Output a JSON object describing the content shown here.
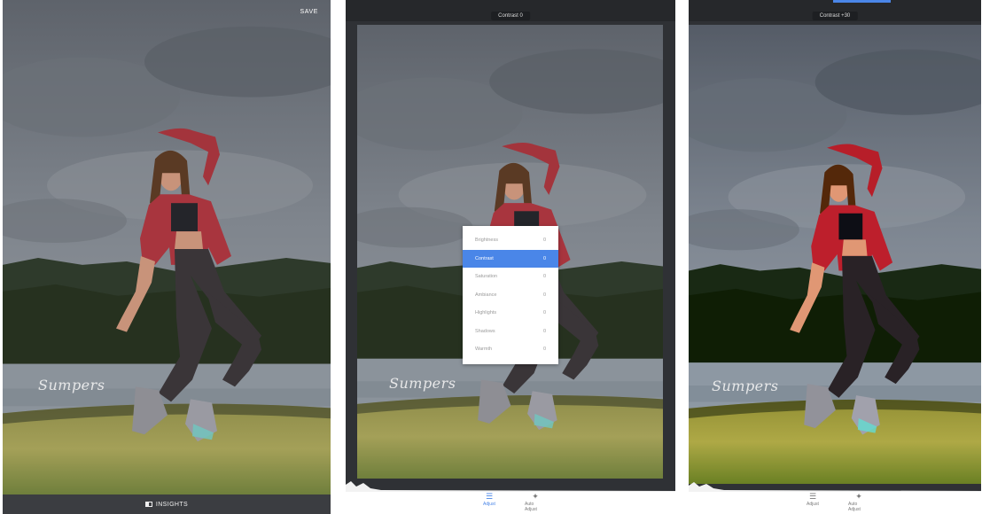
{
  "colors": {
    "accent": "#4a86e8",
    "dark": "#2f3135",
    "menu_bg": "#ffffff"
  },
  "panel1": {
    "save_label": "SAVE",
    "signature_text": "Sumpers",
    "insights_icon": "insights-icon",
    "insights_label": "INSIGHTS"
  },
  "panel2": {
    "indicator": "Contrast 0",
    "signature_text": "Sumpers",
    "menu": [
      {
        "label": "Brightness",
        "value": "0"
      },
      {
        "label": "Contrast",
        "value": "0"
      },
      {
        "label": "Saturation",
        "value": "0"
      },
      {
        "label": "Ambiance",
        "value": "0"
      },
      {
        "label": "Highlights",
        "value": "0"
      },
      {
        "label": "Shadows",
        "value": "0"
      },
      {
        "label": "Warmth",
        "value": "0"
      }
    ],
    "selected_index": 1,
    "tools": [
      {
        "icon": "sliders-icon",
        "label": "Adjust"
      },
      {
        "icon": "auto-adjust-icon",
        "label": "Auto Adjust"
      }
    ]
  },
  "panel3": {
    "indicator": "Contrast +30",
    "signature_text": "Sumpers",
    "tools": [
      {
        "icon": "sliders-icon",
        "label": "Adjust"
      },
      {
        "icon": "auto-adjust-icon",
        "label": "Auto Adjust"
      }
    ]
  }
}
